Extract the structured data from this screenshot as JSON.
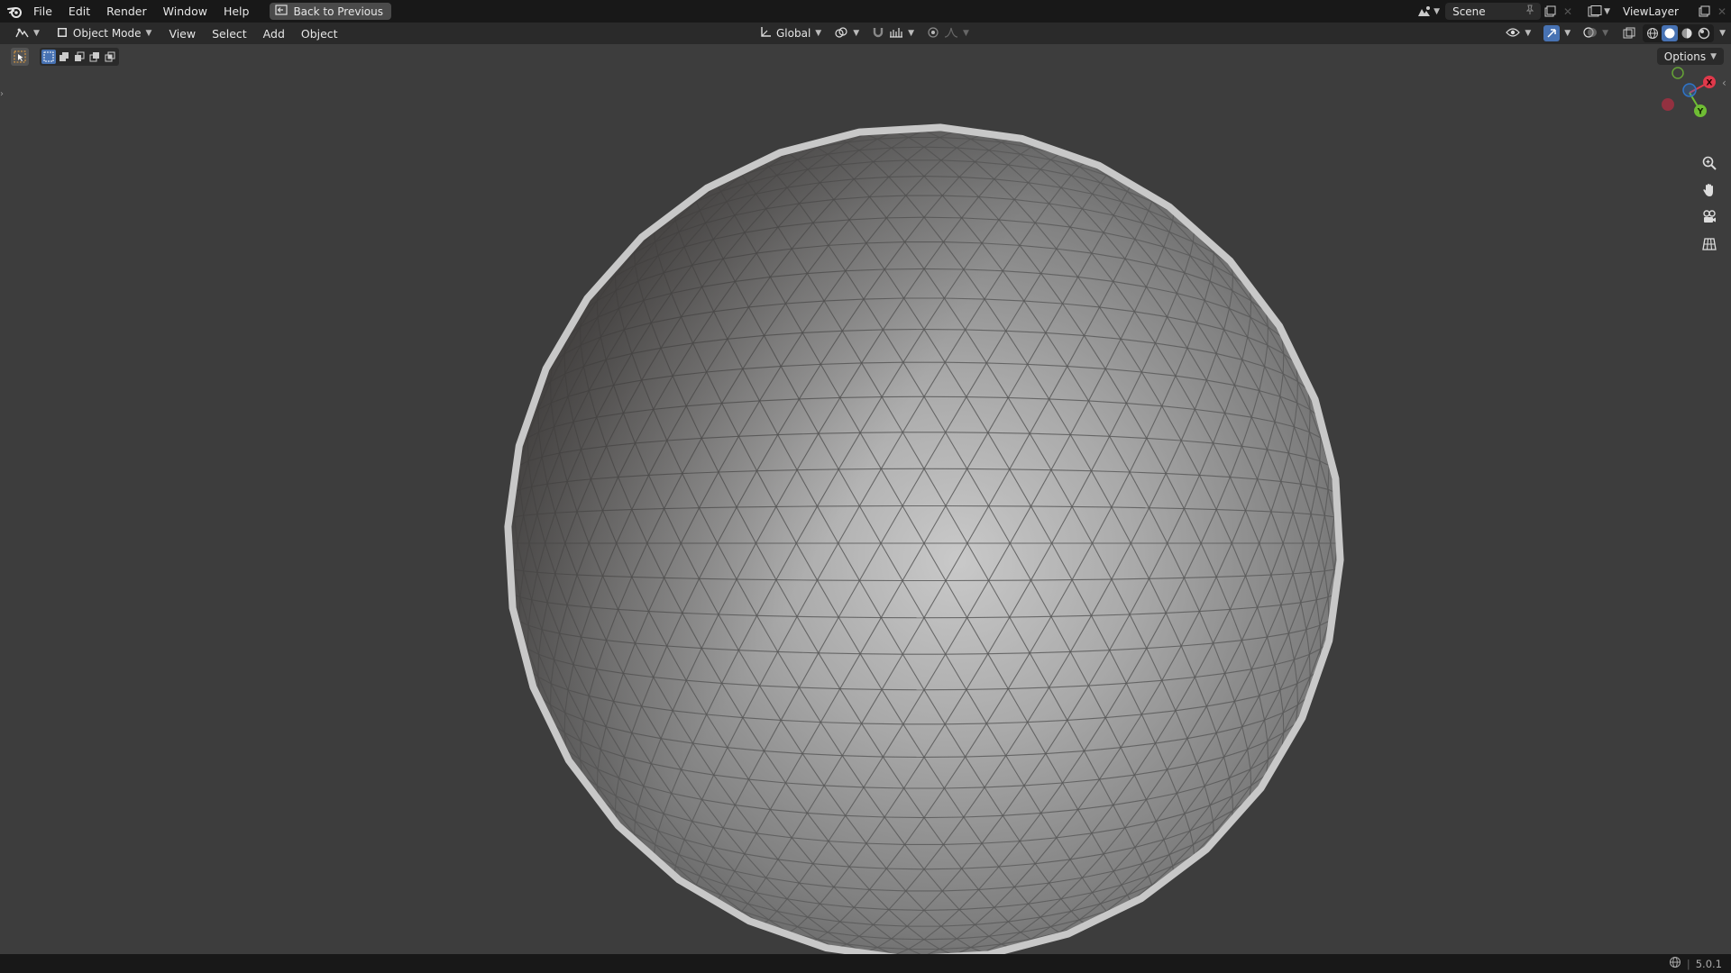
{
  "menubar": {
    "items": [
      "File",
      "Edit",
      "Render",
      "Window",
      "Help"
    ],
    "back_button": "Back to Previous"
  },
  "scene": {
    "value": "Scene"
  },
  "view_layer": {
    "value": "ViewLayer"
  },
  "header": {
    "mode": "Object Mode",
    "menus": [
      "View",
      "Select",
      "Add",
      "Object"
    ],
    "transform_orientation": "Global"
  },
  "viewport": {
    "options_label": "Options",
    "gizmo": {
      "x_label": "X",
      "y_label": "Y",
      "x_color": "#e0394b",
      "y_color": "#6fbd34",
      "z_color": "#2f74c8"
    }
  },
  "status": {
    "version": "5.0.1"
  },
  "colors": {
    "accent": "#4772b3",
    "topbar": "#181818",
    "header": "#2a2a2a",
    "viewport": "#3d3d3d"
  }
}
